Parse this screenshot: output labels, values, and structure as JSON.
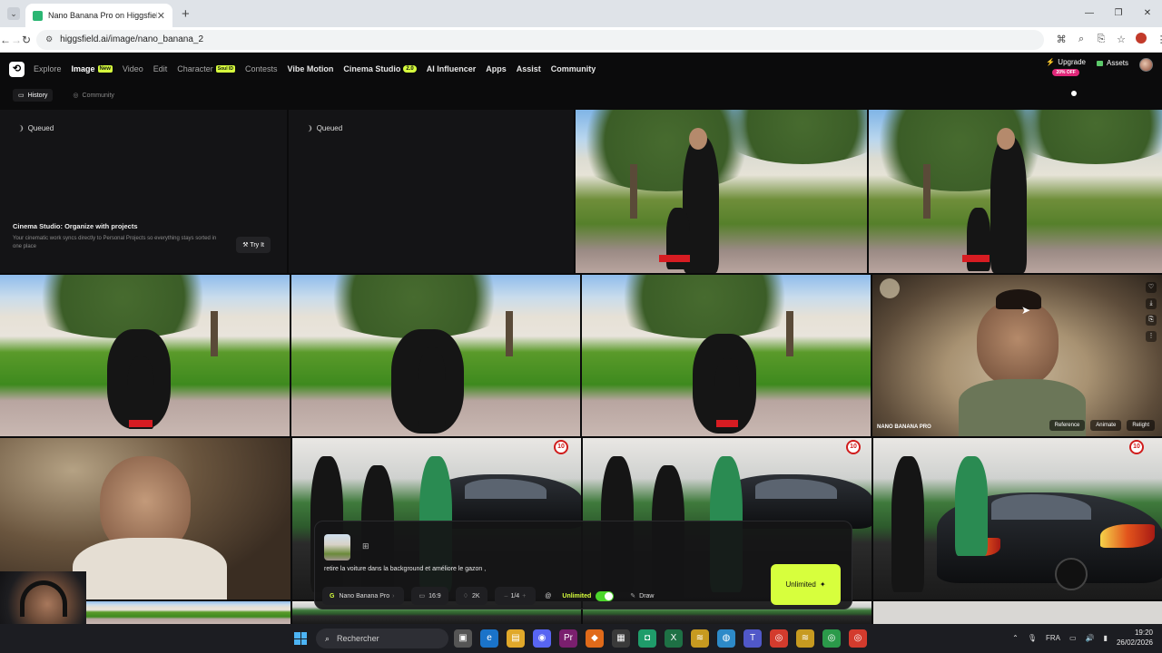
{
  "browser": {
    "tab_title": "Nano Banana Pro on Higgsfield",
    "url": "higgsfield.ai/image/nano_banana_2"
  },
  "nav": {
    "items": [
      {
        "label": "Explore",
        "tag": ""
      },
      {
        "label": "Image",
        "tag": "New"
      },
      {
        "label": "Video",
        "tag": ""
      },
      {
        "label": "Edit",
        "tag": ""
      },
      {
        "label": "Character",
        "tag": "Soul ID"
      },
      {
        "label": "Contests",
        "tag": ""
      },
      {
        "label": "Vibe Motion",
        "tag": ""
      },
      {
        "label": "Cinema Studio",
        "tag": "2.0"
      },
      {
        "label": "AI Influencer",
        "tag": ""
      },
      {
        "label": "Apps",
        "tag": ""
      },
      {
        "label": "Assist",
        "tag": ""
      },
      {
        "label": "Community",
        "tag": ""
      }
    ],
    "upgrade": "Upgrade",
    "discount": "20% OFF",
    "assets": "Assets"
  },
  "subtabs": {
    "history": "History",
    "community": "Community"
  },
  "grid": {
    "queued_label": "Queued",
    "promo_title": "Cinema Studio: Organize with projects",
    "promo_text": "Your cinematic work syncs directly to Personal Projects so everything stays sorted in one place",
    "promo_button": "Try It",
    "hover_label": "NANO BANANA PRO",
    "hover_actions": [
      "Reference",
      "Animate",
      "Relight"
    ],
    "badge_text": "10"
  },
  "prompt": {
    "text": "retire la voiture dans la background et améliore le gazon ,",
    "model": "Nano Banana Pro",
    "ratio": "16:9",
    "quality": "2K",
    "count": "1/4",
    "unlimited_label": "Unlimited",
    "draw": "Draw",
    "generate": "Unlimited"
  },
  "taskbar": {
    "search_placeholder": "Rechercher",
    "lang": "FRA",
    "time": "19:20",
    "date": "26/02/2026"
  },
  "colors": {
    "accent": "#d7ff3d",
    "discount_badge": "#e0287a",
    "toggle_on": "#4cd62c",
    "background": "#0b0b0c"
  }
}
